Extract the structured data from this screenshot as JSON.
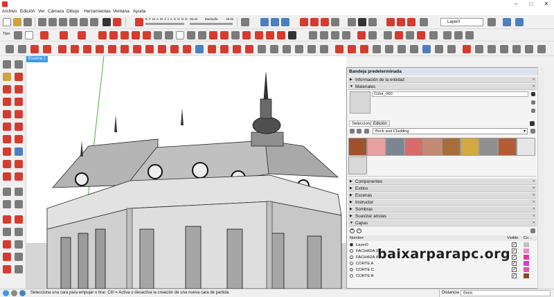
{
  "menu": [
    "Archivo",
    "Edición",
    "Ver",
    "Cámara",
    "Dibujo",
    "Herramientas",
    "Ventana",
    "Ayuda"
  ],
  "toolbar": {
    "months": "E F M A M J J A S O N D",
    "time_start": "06:42",
    "time_mid": "Mediodía",
    "time_end": "19:33",
    "layer_dropdown": "Layer0",
    "tipo_label": "Tipo"
  },
  "scene": {
    "tab": "Escena 1"
  },
  "tray": {
    "title": "Bandeja predeterminada",
    "sections": {
      "entidad": "Información de la entidad",
      "materiales": "Materiales",
      "componentes": "Componentes",
      "estilos": "Estilos",
      "escenas": "Escenas",
      "instructor": "Instructor",
      "sombras": "Sombras",
      "suavizar": "Suavizar aristas",
      "capas": "Capas"
    },
    "material_name": "Color_000",
    "tabs": [
      "Seleccionar",
      "Edición"
    ],
    "library": "Brick and Cladding",
    "swatch_colors": [
      "#a0522d",
      "#e8a0a0",
      "#7a8694",
      "#d96b6b",
      "#c48a75",
      "#a86d3a",
      "#d4a940",
      "#8f8f8f",
      "#b35d35",
      "#e6e6e6",
      "#d9d9d9"
    ],
    "layers": {
      "col_name": "Nombre",
      "col_visible": "Visible",
      "col_color": "Co...",
      "rows": [
        {
          "name": "Layer0",
          "active": true,
          "color": "#c0c0c0"
        },
        {
          "name": "FACHADA 3",
          "active": false,
          "color": "#e889c8"
        },
        {
          "name": "FACHADA 4",
          "active": false,
          "color": "#e3389e"
        },
        {
          "name": "CORTE A",
          "active": false,
          "color": "#d13bd6"
        },
        {
          "name": "CORTE C",
          "active": false,
          "color": "#e052b8"
        },
        {
          "name": "CORTE B",
          "active": false,
          "color": "#8a4a1c"
        }
      ]
    }
  },
  "watermark": "baixarparapc.org",
  "status": {
    "message": "Selecciona una cara para empujar o tirar. Ctrl = Activa o desactiva la creación de una nueva cara de partida.",
    "distance_label": "Distancia",
    "distance_value": "0mm"
  },
  "colors": {
    "accent": "#3d9be9",
    "sketchup_red": "#e0312b"
  }
}
